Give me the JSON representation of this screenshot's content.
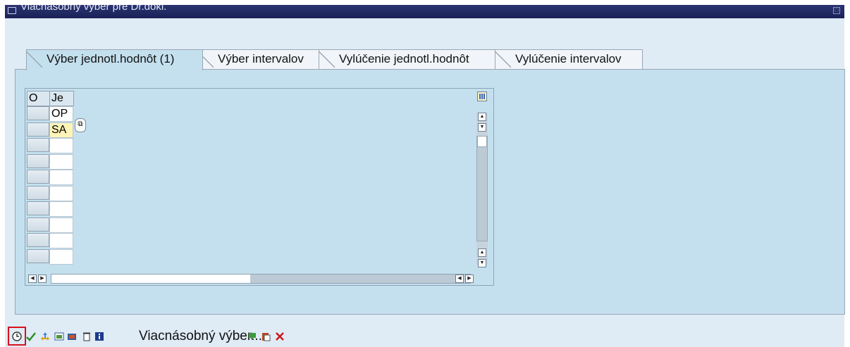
{
  "window": {
    "title": "Viacnásobný výber pre Dr.dokl."
  },
  "tabs": [
    {
      "label": "Výber jednotl.hodnôt (1)",
      "active": true
    },
    {
      "label": "Výber intervalov",
      "active": false
    },
    {
      "label": "Vylúčenie jednotl.hodnôt",
      "active": false
    },
    {
      "label": "Vylúčenie intervalov",
      "active": false
    }
  ],
  "grid": {
    "columns": [
      "O",
      "Je"
    ],
    "rows": [
      "OP",
      "SA",
      "",
      "",
      "",
      "",
      "",
      "",
      "",
      ""
    ],
    "edit_row_value": "SA"
  },
  "toolbar": {
    "multiple_selection_label": "Viacnásobný výber...",
    "icons": [
      "execute-icon",
      "checkmark-icon",
      "navigate-icon",
      "import-icon",
      "export-icon",
      "delete-icon",
      "info-icon",
      "upload-icon",
      "clipboard-icon",
      "cancel-icon"
    ],
    "highlight_color": "#d8121b"
  },
  "colors": {
    "titlebar": "#1b2258",
    "panel": "#c4e0ee",
    "edit_cell": "#fff4b8"
  }
}
